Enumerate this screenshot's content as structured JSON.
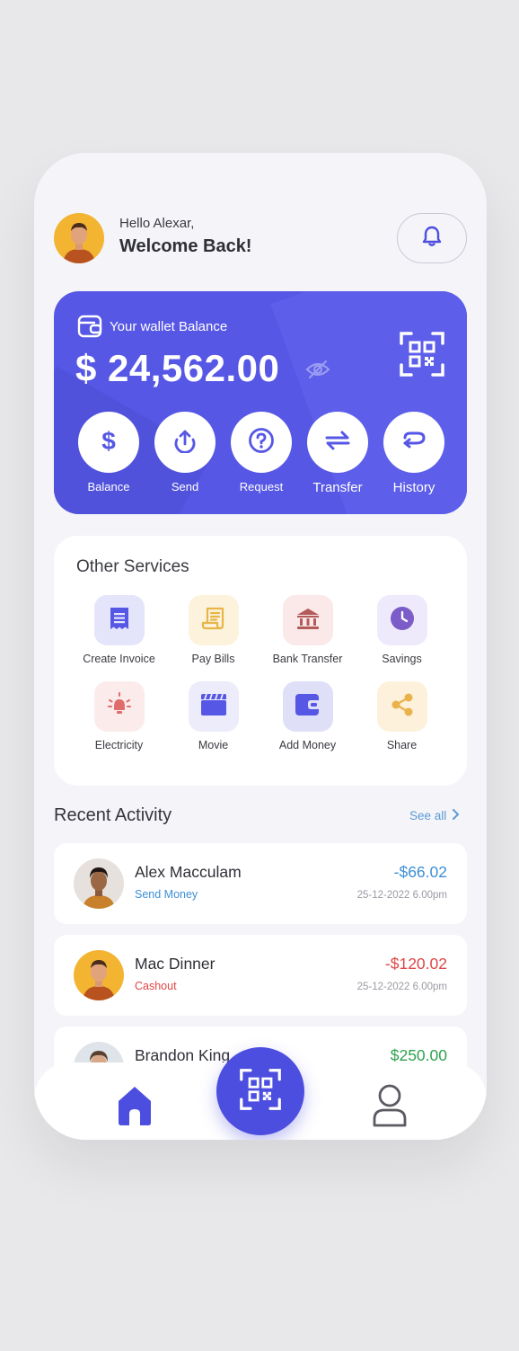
{
  "header": {
    "greeting": "Hello Alexar,",
    "welcome": "Welcome Back!"
  },
  "wallet": {
    "label": "Your wallet Balance",
    "balance": "$ 24,562.00",
    "actions": [
      {
        "label": "Balance",
        "icon": "dollar-icon"
      },
      {
        "label": "Send",
        "icon": "upload-icon"
      },
      {
        "label": "Request",
        "icon": "question-icon"
      },
      {
        "label": "Transfer",
        "icon": "transfer-icon"
      },
      {
        "label": "History",
        "icon": "history-icon"
      }
    ]
  },
  "services": {
    "title": "Other Services",
    "items": [
      {
        "label": "Create Invoice",
        "icon": "invoice-icon",
        "color": "#5657e5",
        "bg": "#e4e5fb"
      },
      {
        "label": "Pay Bills",
        "icon": "bill-icon",
        "color": "#e8b548",
        "bg": "#fdf3dd"
      },
      {
        "label": "Bank Transfer",
        "icon": "bank-icon",
        "color": "#b35a5a",
        "bg": "#fbe9e9"
      },
      {
        "label": "Savings",
        "icon": "clock-icon",
        "color": "#7b5cc8",
        "bg": "#efeafb"
      },
      {
        "label": "Electricity",
        "icon": "bulb-icon",
        "color": "#e06b6b",
        "bg": "#fcebeb"
      },
      {
        "label": "Movie",
        "icon": "clapper-icon",
        "color": "#5657e5",
        "bg": "#ececfa"
      },
      {
        "label": "Add Money",
        "icon": "wallet-icon",
        "color": "#5657e5",
        "bg": "#dfe0f8"
      },
      {
        "label": "Share",
        "icon": "share-icon",
        "color": "#eab24a",
        "bg": "#fdf1dc"
      }
    ]
  },
  "recent": {
    "title": "Recent Activity",
    "see_all": "See all",
    "transactions": [
      {
        "name": "Alex Macculam",
        "kind": "Send Money",
        "kind_color": "#3d8fd6",
        "amount": "-$66.02",
        "amount_color": "#3d8fd6",
        "date": "25-12-2022  6.00pm"
      },
      {
        "name": "Mac Dinner",
        "kind": "Cashout",
        "kind_color": "#e04646",
        "amount": "-$120.02",
        "amount_color": "#e04646",
        "date": "25-12-2022  6.00pm"
      },
      {
        "name": "Brandon King",
        "kind": "",
        "kind_color": "#2fa14f",
        "amount": "$250.00",
        "amount_color": "#2fa14f",
        "date": ""
      }
    ]
  },
  "nav": {
    "home_icon": "home-icon",
    "scan_icon": "qr-scan-icon",
    "profile_icon": "profile-icon"
  },
  "colors": {
    "primary": "#5657e5",
    "background": "#f4f4f9"
  }
}
